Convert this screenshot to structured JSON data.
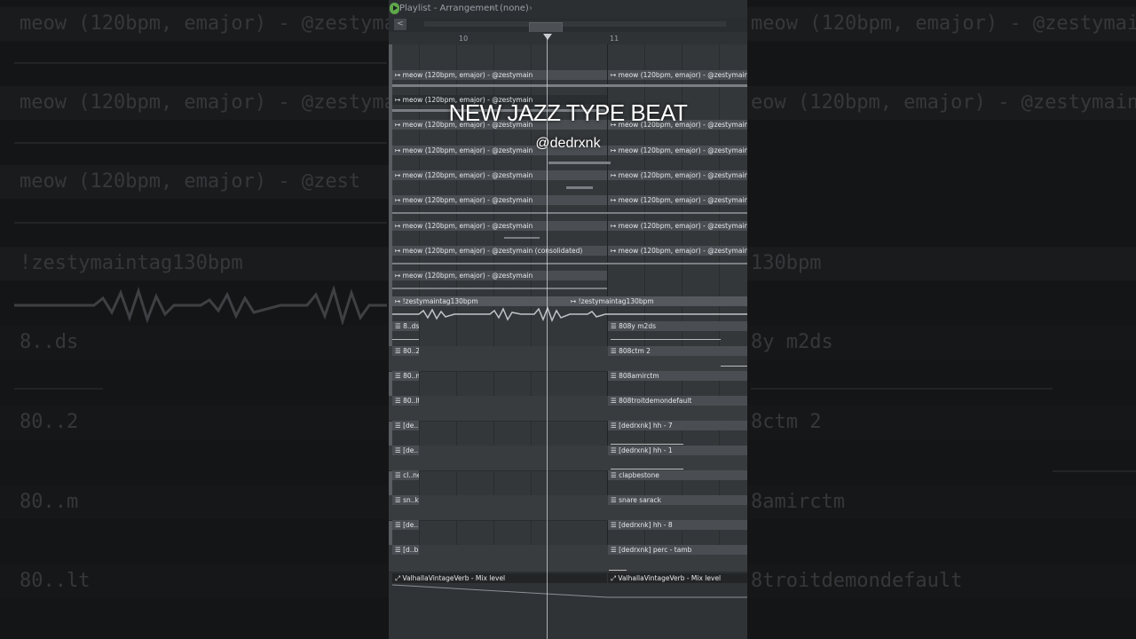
{
  "window": {
    "title": "Playlist - Arrangement",
    "pattern": "(none)",
    "scroll_left_symbol": "<"
  },
  "ruler": {
    "bar_10": "10",
    "bar_11": "11"
  },
  "overlay": {
    "title": "NEW JAZZ TYPE BEAT",
    "handle": "@dedrxnk"
  },
  "clips": {
    "meow": "meow (120bpm, emajor) - @zestymain",
    "meow_consolidated": "meow (120bpm, emajor) - @zestymain (consolidated)",
    "tag": "!zestymaintag130bpm"
  },
  "pattern_clips": [
    {
      "short": "8..ds",
      "full": "808y m2ds"
    },
    {
      "short": "80..2",
      "full": "808ctm 2"
    },
    {
      "short": "80..m",
      "full": "808amirctm"
    },
    {
      "short": "80..lt",
      "full": "808troitdemondefault"
    },
    {
      "short": "[de..",
      "full": "[dedrxnk] hh - 7"
    },
    {
      "short": "[de..",
      "full": "[dedrxnk] hh - 1"
    },
    {
      "short": "cl..ne",
      "full": "clapbestone"
    },
    {
      "short": "sn..k",
      "full": "snare sarack"
    },
    {
      "short": "[de..",
      "full": "[dedrxnk] hh - 8"
    },
    {
      "short": "[d..b",
      "full": "[dedrxnk] perc - tamb"
    }
  ],
  "automation": {
    "label": "ValhallaVintageVerb - Mix level"
  },
  "background": {
    "row1": "meow (120bpm, emajor) - @zestymain",
    "row1_right": "meow (120bpm, emajor) - @zestymain",
    "row2": "meow (120bpm, emajor) - @zestymain",
    "row2_right": "eow (120bpm, emajor) - @zestymain",
    "row3": "meow (120bpm, emajor) - @zest",
    "row4": "!zestymaintag130bpm",
    "row4_right": "130bpm",
    "row5": "8..ds",
    "row5_right": "8y m2ds",
    "row6": "80..2",
    "row6_right": "8ctm 2",
    "row7": "80..m",
    "row7_right": "8amirctm",
    "row8": "80..lt",
    "row8_right": "8troitdemondefault"
  },
  "colors": {
    "clip_header": "#4a4e52",
    "waveform": "#7a7f84",
    "fl_green": "#5ea84a"
  }
}
